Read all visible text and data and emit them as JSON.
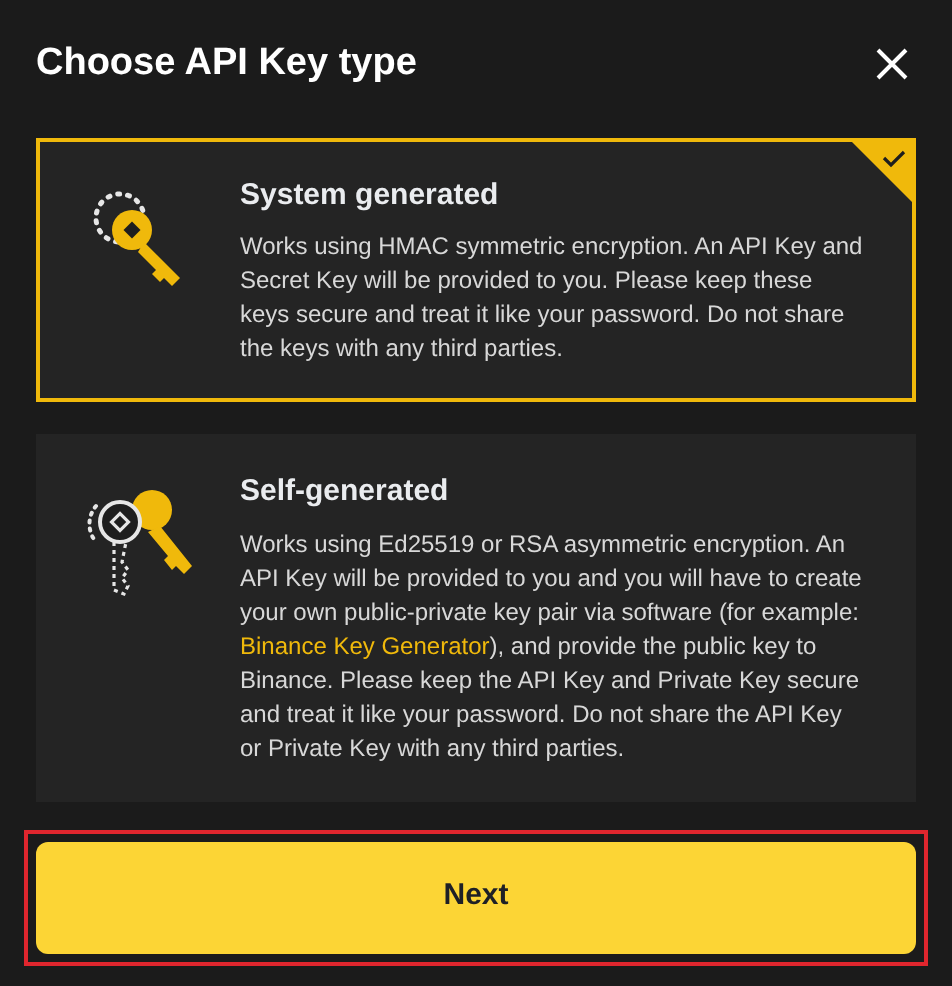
{
  "title": "Choose API Key type",
  "options": [
    {
      "kind": "system",
      "title": "System generated",
      "selected": true,
      "description": "Works using HMAC symmetric encryption. An API Key and Secret Key will be provided to you. Please keep these keys secure and treat it like your password. Do not share the keys with any third parties."
    },
    {
      "kind": "self",
      "title": "Self-generated",
      "selected": false,
      "description_before": "Works using Ed25519 or RSA asymmetric encryption. An API Key will be provided to you and you will have to create your own public-private key pair via software (for example: ",
      "link": "Binance Key Generator",
      "description_after": "), and provide the public key to Binance. Please keep the API Key and Private Key secure and treat it like your password. Do not share the API Key or Private Key with any third parties."
    }
  ],
  "next_button": "Next",
  "highlighted": true
}
